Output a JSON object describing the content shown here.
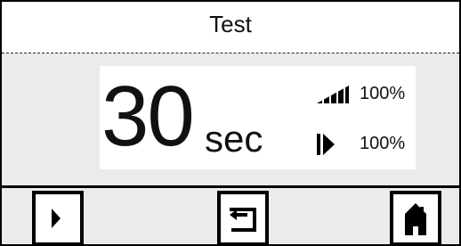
{
  "header": {
    "title": "Test"
  },
  "duration": {
    "value": "30",
    "unit": "sec"
  },
  "stats": {
    "intensity": {
      "icon": "signal-strength-icon",
      "value": "100%"
    },
    "output": {
      "icon": "pulse-output-icon",
      "value": "100%"
    }
  },
  "softkeys": [
    {
      "icon": "play-icon"
    },
    {
      "icon": "back-return-icon"
    },
    {
      "icon": "home-icon"
    }
  ],
  "colors": {
    "foreground": "#000000",
    "panel": "#ffffff",
    "screen": "#ebebeb"
  }
}
